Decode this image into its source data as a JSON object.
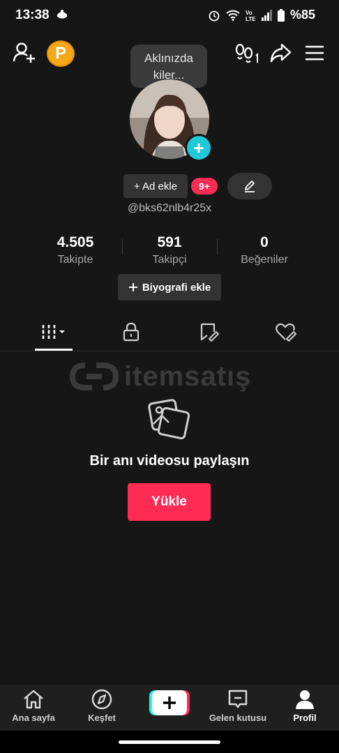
{
  "status_bar": {
    "time": "13:38",
    "battery": "%85"
  },
  "header": {
    "points_badge": "P",
    "bubble_text": "Aklınızda kiler..."
  },
  "profile": {
    "add_name_label": "+ Ad ekle",
    "notification_badge": "9+",
    "username": "@bks62nlb4r25x",
    "add_bio_label": "Biyografi ekle"
  },
  "stats": [
    {
      "value": "4.505",
      "label": "Takipte"
    },
    {
      "value": "591",
      "label": "Takipçi"
    },
    {
      "value": "0",
      "label": "Beğeniler"
    }
  ],
  "tabs": [
    {
      "icon": "grid-icon",
      "active": true
    },
    {
      "icon": "lock-icon",
      "active": false
    },
    {
      "icon": "repost-icon",
      "active": false
    },
    {
      "icon": "liked-icon",
      "active": false
    }
  ],
  "watermark": {
    "text": "itemsatış"
  },
  "empty_state": {
    "title": "Bir anı videosu paylaşın",
    "button_label": "Yükle"
  },
  "bottom_nav": [
    {
      "label": "Ana sayfa",
      "icon": "home-icon"
    },
    {
      "label": "Keşfet",
      "icon": "compass-icon"
    },
    {
      "label": "",
      "icon": "plus-icon"
    },
    {
      "label": "Gelen kutusu",
      "icon": "inbox-icon"
    },
    {
      "label": "Profil",
      "icon": "profile-icon",
      "active": true
    }
  ],
  "colors": {
    "accent": "#fe2c55",
    "teal": "#20c8d8",
    "points": "#f6a818",
    "background": "#161616"
  }
}
